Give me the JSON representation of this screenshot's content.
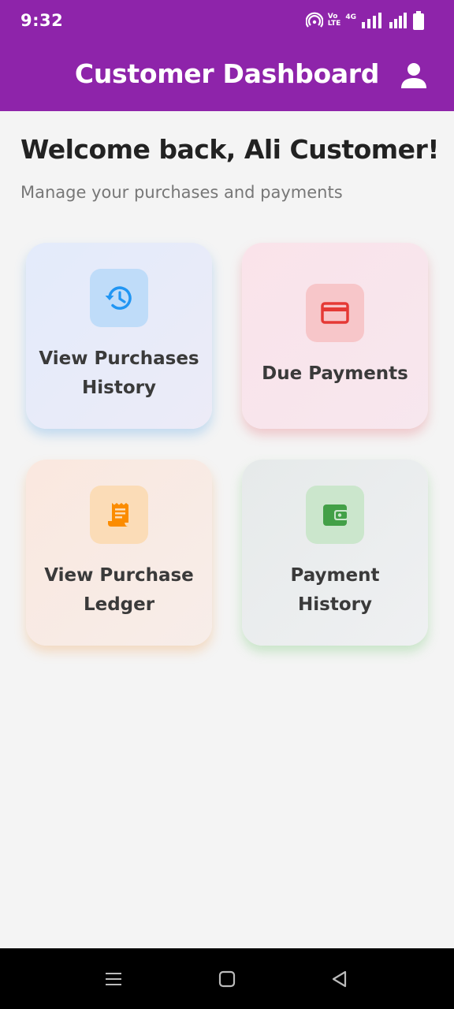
{
  "status_bar": {
    "time": "9:32",
    "icons": [
      "hotspot-icon",
      "volte-icon",
      "signal-icon",
      "signal-icon",
      "battery-icon"
    ],
    "lte_top": "Vo",
    "lte_bottom": "LTE",
    "network": "4G"
  },
  "app_bar": {
    "title": "Customer Dashboard",
    "profile_icon": "person-icon",
    "background": "#8e24aa"
  },
  "main": {
    "welcome": "Welcome back, Ali Customer!",
    "subtitle": "Manage your purchases and payments"
  },
  "cards": [
    {
      "label": "View Purchases History",
      "icon": "history-icon",
      "accent": "#2196f3"
    },
    {
      "label": "Due Payments",
      "icon": "credit-card-icon",
      "accent": "#e53935"
    },
    {
      "label": "View Purchase Ledger",
      "icon": "receipt-icon",
      "accent": "#fb8c00"
    },
    {
      "label": "Payment History",
      "icon": "wallet-icon",
      "accent": "#43a047"
    }
  ],
  "nav_bar": {
    "buttons": [
      "menu-icon",
      "home-square-icon",
      "back-triangle-icon"
    ]
  }
}
